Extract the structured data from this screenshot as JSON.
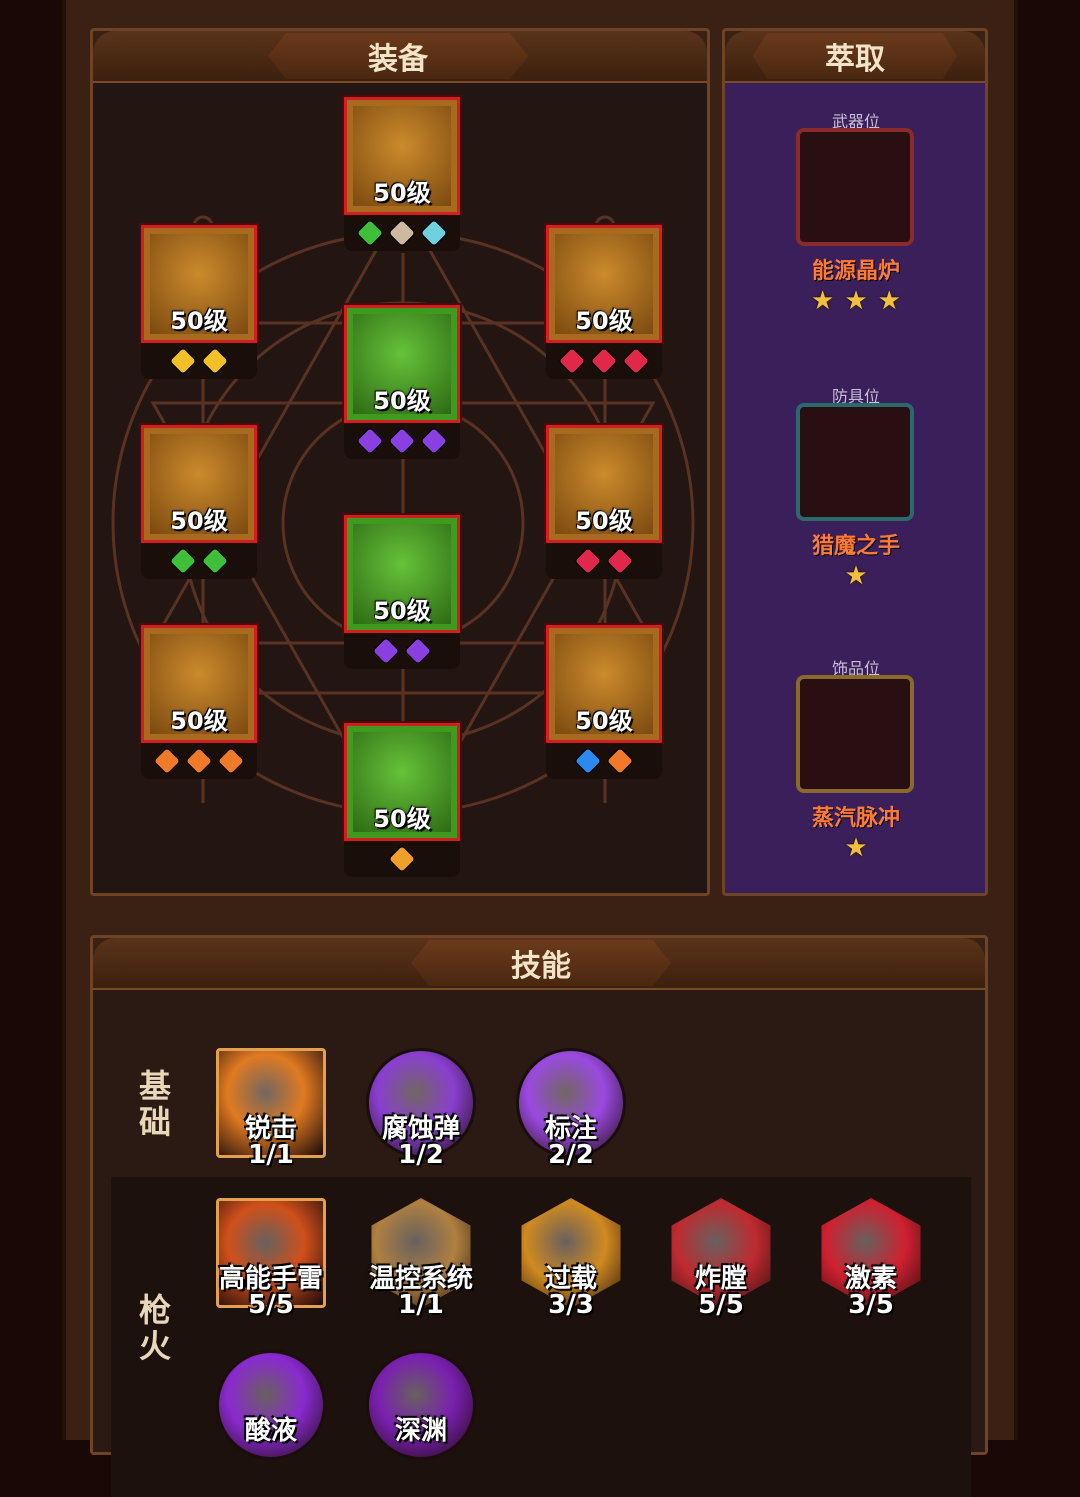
{
  "equipment": {
    "title": "装备",
    "slots": [
      {
        "id": "helmet",
        "level": "50级",
        "gems": [
          "#3fbf3a",
          "#cdb8a0",
          "#6fd0e0"
        ]
      },
      {
        "id": "shoulder",
        "level": "50级",
        "gems": [
          "#f0c02a",
          "#f0c02a"
        ]
      },
      {
        "id": "necklace",
        "level": "50级",
        "gems": [
          "#e0284a",
          "#e0284a",
          "#e0284a"
        ]
      },
      {
        "id": "armor",
        "level": "50级",
        "gems": [
          "#8a3fe0",
          "#8a3fe0",
          "#8a3fe0"
        ]
      },
      {
        "id": "gloves",
        "level": "50级",
        "gems": [
          "#3fbf3a",
          "#3fbf3a"
        ]
      },
      {
        "id": "ring",
        "level": "50级",
        "gems": [
          "#e0284a",
          "#e0284a"
        ]
      },
      {
        "id": "pants",
        "level": "50级",
        "gems": [
          "#8a3fe0",
          "#8a3fe0"
        ]
      },
      {
        "id": "weapon",
        "level": "50级",
        "gems": [
          "#f07a2a",
          "#f07a2a",
          "#f07a2a"
        ]
      },
      {
        "id": "pet",
        "level": "50级",
        "gems": [
          "#2a8af0",
          "#f07a2a"
        ]
      },
      {
        "id": "boots",
        "level": "50级",
        "gems": [
          "#f0a02a"
        ]
      }
    ]
  },
  "extraction": {
    "title": "萃取",
    "slots": [
      {
        "type": "武器位",
        "name": "能源晶炉",
        "stars": [
          "★",
          "★",
          "★"
        ]
      },
      {
        "type": "防具位",
        "name": "猎魔之手",
        "stars": [
          "★"
        ]
      },
      {
        "type": "饰品位",
        "name": "蒸汽脉冲",
        "stars": [
          "★"
        ]
      }
    ]
  },
  "skills": {
    "title": "技能",
    "rows": [
      {
        "label": "基础",
        "items": [
          {
            "name": "锐击",
            "level": "1/1",
            "color": "#e07a20"
          },
          {
            "name": "腐蚀弹",
            "level": "1/2",
            "color": "#8a3fd0"
          },
          {
            "name": "标注",
            "level": "2/2",
            "color": "#9a4ae0"
          }
        ]
      },
      {
        "label": "枪火",
        "items": [
          {
            "name": "高能手雷",
            "level": "5/5",
            "color": "#d0501a"
          },
          {
            "name": "温控系统",
            "level": "1/1",
            "color": "#b08040"
          },
          {
            "name": "过载",
            "level": "3/3",
            "color": "#d08a20"
          },
          {
            "name": "炸膛",
            "level": "5/5",
            "color": "#c02a30"
          },
          {
            "name": "激素",
            "level": "3/5",
            "color": "#d02030"
          },
          {
            "name": "酸液",
            "level": "",
            "color": "#8a2ad0"
          },
          {
            "name": "深渊",
            "level": "",
            "color": "#7a20b0"
          }
        ]
      }
    ]
  }
}
